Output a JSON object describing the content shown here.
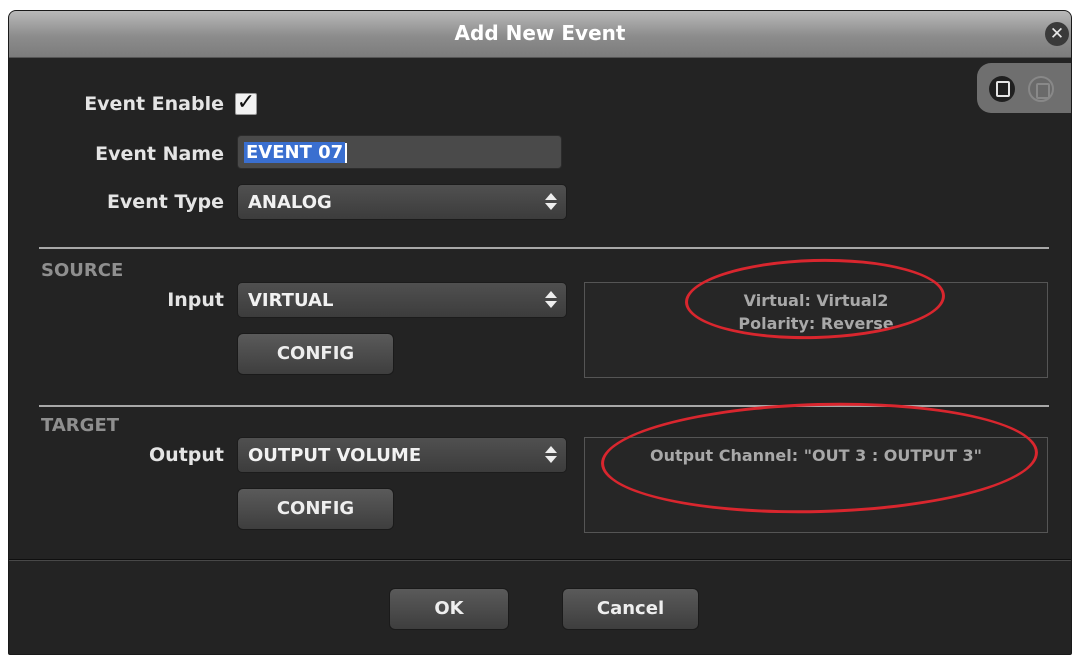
{
  "dialog": {
    "title": "Add New Event",
    "close_icon": "close-icon",
    "copy_icon": "copy-icon",
    "paste_icon": "paste-icon"
  },
  "fields": {
    "enable_label": "Event Enable",
    "enable_checked": true,
    "enable_mark": "✓",
    "name_label": "Event Name",
    "name_value": "EVENT 07",
    "type_label": "Event Type",
    "type_value": "ANALOG"
  },
  "source": {
    "heading": "SOURCE",
    "input_label": "Input",
    "input_value": "VIRTUAL",
    "config_label": "CONFIG",
    "info": [
      "Virtual: Virtual2",
      "Polarity: Reverse"
    ]
  },
  "target": {
    "heading": "TARGET",
    "output_label": "Output",
    "output_value": "OUTPUT VOLUME",
    "config_label": "CONFIG",
    "info": [
      "Output Channel: \"OUT 3 : OUTPUT 3\""
    ]
  },
  "footer": {
    "ok_label": "OK",
    "cancel_label": "Cancel"
  },
  "colors": {
    "highlight_ellipse": "#d9262e",
    "selection": "#3a6fd0"
  }
}
